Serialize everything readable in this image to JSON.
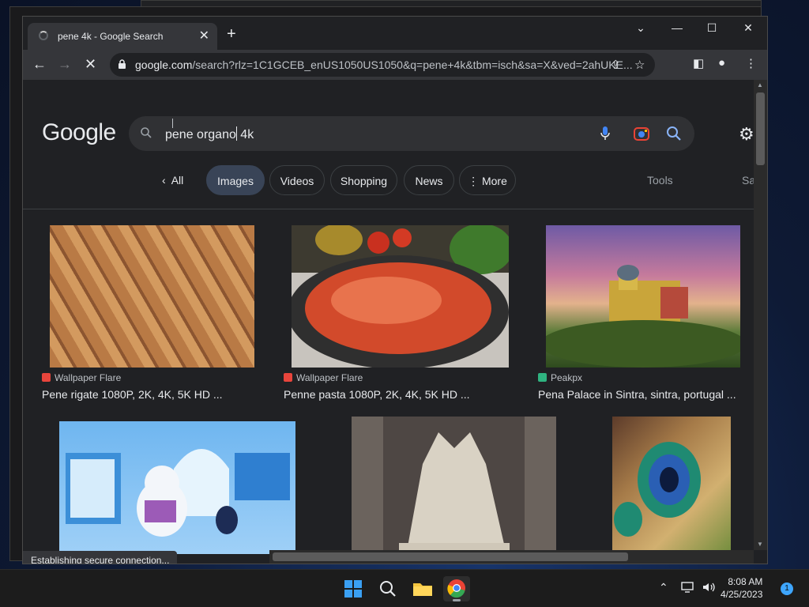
{
  "browser": {
    "tab": {
      "title": "pene 4k - Google Search",
      "close": "✕"
    },
    "new_tab": "+",
    "window_controls": {
      "list": "⌄",
      "minimize": "—",
      "maximize": "☐",
      "close": "✕"
    },
    "nav": {
      "back": "←",
      "forward": "→",
      "reload": "✕"
    },
    "url": {
      "host": "google.com",
      "path": "/search?rlz=1C1GCEB_enUS1050US1050&q=pene+4k&tbm=isch&sa=X&ved=2ahUKE..."
    },
    "status_text": "Establishing secure connection..."
  },
  "search": {
    "logo": "Google",
    "query": "pene organo",
    "query_after_caret": " 4k",
    "filters": [
      {
        "label": "All",
        "prefix": "‹"
      },
      {
        "label": "Images",
        "active": true
      },
      {
        "label": "Videos"
      },
      {
        "label": "Shopping"
      },
      {
        "label": "News"
      },
      {
        "label": "More",
        "prefix": "⋮"
      }
    ],
    "tools": "Tools",
    "safesearch_partial": "Sa"
  },
  "results": [
    {
      "source": "Wallpaper Flare",
      "title": "Pene rigate 1080P, 2K, 4K, 5K HD ...",
      "source_color": "#e8453c"
    },
    {
      "source": "Wallpaper Flare",
      "title": "Penne pasta 1080P, 2K, 4K, 5K HD ...",
      "source_color": "#e8453c"
    },
    {
      "source": "Peakpx",
      "title": "Pena Palace in Sintra, sintra, portugal ...",
      "source_color": "#2fb380"
    },
    {
      "source": "",
      "title": ""
    },
    {
      "source": "",
      "title": ""
    },
    {
      "source": "",
      "title": ""
    }
  ],
  "taskbar": {
    "clock_time": "8:08 AM",
    "clock_date": "4/25/2023",
    "notification_count": "1"
  },
  "colors": {
    "page_bg": "#202124",
    "accent": "#8ab4f8",
    "chip_active": "#394457"
  }
}
